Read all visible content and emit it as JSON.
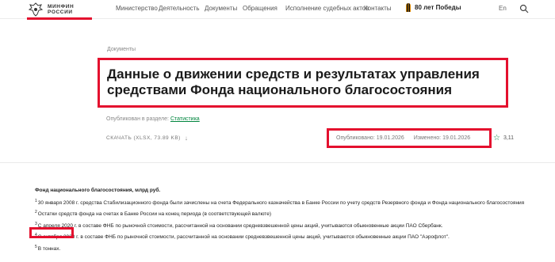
{
  "header": {
    "logo_lines": [
      "МИНФИН",
      "РОССИИ"
    ],
    "nav": [
      "Министерство",
      "Деятельность",
      "Документы",
      "Обращения",
      "Исполнение судебных актов",
      "Контакты"
    ],
    "victory": "80 лет Победы",
    "lang": "En"
  },
  "breadcrumb": "Документы",
  "title": "Данные о движении средств и результатах управления средствами Фонда национального благосостояния",
  "published_in": {
    "label": "Опубликован в разделе:",
    "link": "Статистика"
  },
  "download": {
    "label": "СКАЧАТЬ (XLSX, 73.89 KB)"
  },
  "dates": {
    "published": "Опубликовано: 19.01.2026",
    "changed": "Изменено: 19.01.2026"
  },
  "rating": "3,11",
  "notes": {
    "title": "Фонд национального благосостояния, млрд руб.",
    "items": [
      {
        "num": "1",
        "text": "30 января 2008 г. средства Стабилизационного фонда были зачислены на счета Федерального казначейства в Банке России по учету средств Резервного фонда и Фонда национального благосостояния"
      },
      {
        "num": "2",
        "text": "Остатки средств фонда на счетах в Банке России на конец периода (в соответствующей валюте)"
      },
      {
        "num": "3",
        "text": "С апреля 2020 г. в составе ФНБ по рыночной стоимости, рассчитанной на основании средневзвешенной цены акций, учитываются обыкновенные акции ПАО Сбербанк."
      },
      {
        "num": "4",
        "text": "С октября 2020 г. в составе ФНБ по рыночной стоимости, рассчитанной на основании средневзвешенной цены акций, учитываются обыкновенные акции ПАО \"Аэрофлот\"."
      },
      {
        "num": "5",
        "text": "В тоннах."
      }
    ]
  },
  "colors": {
    "accent": "#e4102e",
    "link": "#00853e"
  }
}
